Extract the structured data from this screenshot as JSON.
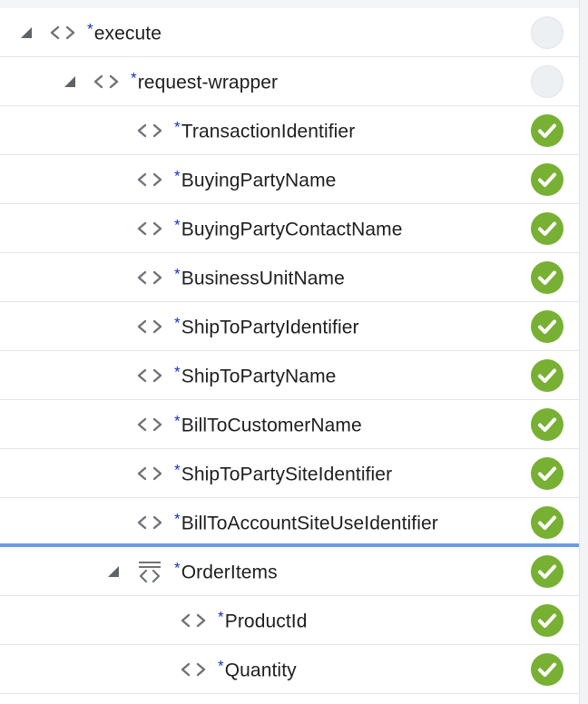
{
  "colors": {
    "accent_selection": "#6a9bdf",
    "ok_green": "#78b034",
    "required_marker": "#1230c8",
    "empty_status": "#edf0f3"
  },
  "tree": {
    "required_marker": "*",
    "rows": [
      {
        "label": "execute",
        "depth": 0,
        "expanded": true,
        "icon": "element-icon",
        "status": "none"
      },
      {
        "label": "request-wrapper",
        "depth": 1,
        "expanded": true,
        "icon": "element-icon",
        "status": "none"
      },
      {
        "label": "TransactionIdentifier",
        "depth": 2,
        "icon": "element-icon",
        "status": "ok"
      },
      {
        "label": "BuyingPartyName",
        "depth": 2,
        "icon": "element-icon",
        "status": "ok"
      },
      {
        "label": "BuyingPartyContactName",
        "depth": 2,
        "icon": "element-icon",
        "status": "ok"
      },
      {
        "label": "BusinessUnitName",
        "depth": 2,
        "icon": "element-icon",
        "status": "ok"
      },
      {
        "label": "ShipToPartyIdentifier",
        "depth": 2,
        "icon": "element-icon",
        "status": "ok"
      },
      {
        "label": "ShipToPartyName",
        "depth": 2,
        "icon": "element-icon",
        "status": "ok"
      },
      {
        "label": "BillToCustomerName",
        "depth": 2,
        "icon": "element-icon",
        "status": "ok"
      },
      {
        "label": "ShipToPartySiteIdentifier",
        "depth": 2,
        "icon": "element-icon",
        "status": "ok"
      },
      {
        "label": "BillToAccountSiteUseIdentifier",
        "depth": 2,
        "icon": "element-icon",
        "status": "ok"
      },
      {
        "label": "OrderItems",
        "depth": 2,
        "expanded": true,
        "icon": "repeating-element-icon",
        "status": "ok",
        "selected": true
      },
      {
        "label": "ProductId",
        "depth": 3,
        "icon": "element-icon",
        "status": "ok"
      },
      {
        "label": "Quantity",
        "depth": 3,
        "icon": "element-icon",
        "status": "ok"
      }
    ]
  }
}
